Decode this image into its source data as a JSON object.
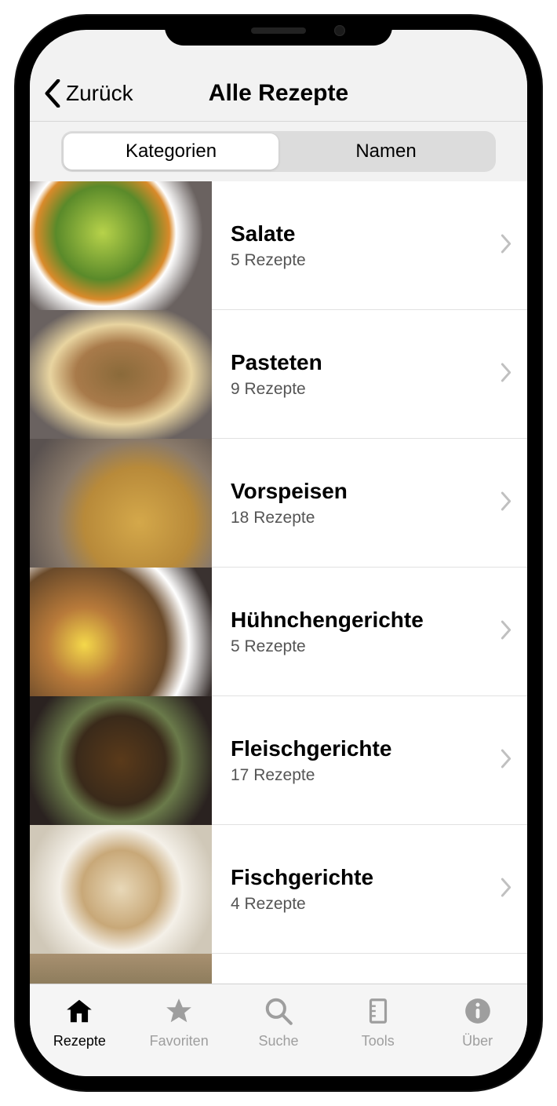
{
  "nav": {
    "back_label": "Zurück",
    "title": "Alle Rezepte"
  },
  "segmented": {
    "options": [
      "Kategorien",
      "Namen"
    ],
    "active_index": 0
  },
  "categories": [
    {
      "name": "Salate",
      "count": 5,
      "unit": "Rezepte"
    },
    {
      "name": "Pasteten",
      "count": 9,
      "unit": "Rezepte"
    },
    {
      "name": "Vorspeisen",
      "count": 18,
      "unit": "Rezepte"
    },
    {
      "name": "Hühnchengerichte",
      "count": 5,
      "unit": "Rezepte"
    },
    {
      "name": "Fleischgerichte",
      "count": 17,
      "unit": "Rezepte"
    },
    {
      "name": "Fischgerichte",
      "count": 4,
      "unit": "Rezepte"
    }
  ],
  "tabbar": {
    "items": [
      {
        "label": "Rezepte",
        "icon": "home-icon"
      },
      {
        "label": "Favoriten",
        "icon": "star-icon"
      },
      {
        "label": "Suche",
        "icon": "search-icon"
      },
      {
        "label": "Tools",
        "icon": "beaker-icon"
      },
      {
        "label": "Über",
        "icon": "info-icon"
      }
    ],
    "active_index": 0
  }
}
